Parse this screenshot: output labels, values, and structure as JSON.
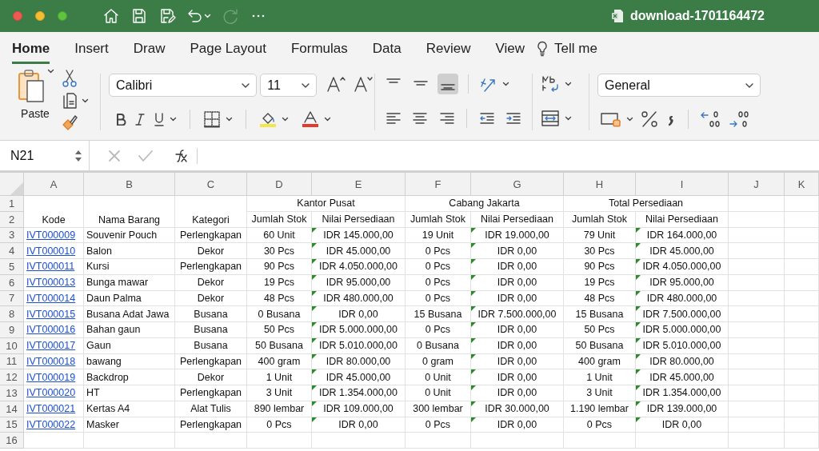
{
  "window": {
    "title": "download-1701164472"
  },
  "quick_access": [
    {
      "kind": "home",
      "disabled": false
    },
    {
      "kind": "save",
      "disabled": false
    },
    {
      "kind": "save-as",
      "disabled": false
    },
    {
      "kind": "undo",
      "disabled": false
    },
    {
      "kind": "redo",
      "disabled": true
    },
    {
      "kind": "more",
      "disabled": false
    }
  ],
  "tabs": [
    {
      "label": "Home",
      "selected": true
    },
    {
      "label": "Insert",
      "selected": false
    },
    {
      "label": "Draw",
      "selected": false
    },
    {
      "label": "Page Layout",
      "selected": false
    },
    {
      "label": "Formulas",
      "selected": false
    },
    {
      "label": "Data",
      "selected": false
    },
    {
      "label": "Review",
      "selected": false
    },
    {
      "label": "View",
      "selected": false
    }
  ],
  "tell_me": "Tell me",
  "ribbon": {
    "paste_label": "Paste",
    "font_name": "Calibri",
    "font_size": "11",
    "number_format": "General",
    "vertical_align": [
      {
        "selected": false
      },
      {
        "selected": false
      },
      {
        "selected": true
      }
    ]
  },
  "formula_bar": {
    "name_box": "N21"
  },
  "table": {
    "columns": [
      {
        "letter": "A",
        "kind": "link",
        "error_flag": false
      },
      {
        "letter": "B",
        "kind": "text",
        "error_flag": false
      },
      {
        "letter": "C",
        "kind": "value",
        "error_flag": false
      },
      {
        "letter": "D",
        "kind": "value",
        "error_flag": false
      },
      {
        "letter": "E",
        "kind": "value",
        "error_flag": true
      },
      {
        "letter": "F",
        "kind": "value",
        "error_flag": false
      },
      {
        "letter": "G",
        "kind": "value",
        "error_flag": true
      },
      {
        "letter": "H",
        "kind": "value",
        "error_flag": false
      },
      {
        "letter": "I",
        "kind": "value",
        "error_flag": true
      },
      {
        "letter": "J",
        "kind": "value",
        "error_flag": false
      },
      {
        "letter": "K",
        "kind": "value",
        "error_flag": false
      }
    ],
    "header_row_numbers": [
      "1",
      "2"
    ],
    "group_headers": [
      "Kantor Pusat",
      "Cabang Jakarta",
      "Total Persediaan"
    ],
    "column_headers": [
      "Kode",
      "Nama Barang",
      "Kategori",
      "Jumlah Stok",
      "Nilai Persediaan",
      "Jumlah Stok",
      "Nilai Persediaan",
      "Jumlah Stok",
      "Nilai Persediaan"
    ],
    "rows": [
      {
        "number": "3",
        "cells": [
          "IVT000009",
          "Souvenir Pouch",
          "Perlengkapan",
          "60 Unit",
          "IDR 145.000,00",
          "19 Unit",
          "IDR 19.000,00",
          "79 Unit",
          "IDR 164.000,00"
        ]
      },
      {
        "number": "4",
        "cells": [
          "IVT000010",
          "Balon",
          "Dekor",
          "30 Pcs",
          "IDR 45.000,00",
          "0 Pcs",
          "IDR 0,00",
          "30 Pcs",
          "IDR 45.000,00"
        ]
      },
      {
        "number": "5",
        "cells": [
          "IVT000011",
          "Kursi",
          "Perlengkapan",
          "90 Pcs",
          "IDR 4.050.000,00",
          "0 Pcs",
          "IDR 0,00",
          "90 Pcs",
          "IDR 4.050.000,00"
        ]
      },
      {
        "number": "6",
        "cells": [
          "IVT000013",
          "Bunga mawar",
          "Dekor",
          "19 Pcs",
          "IDR 95.000,00",
          "0 Pcs",
          "IDR 0,00",
          "19 Pcs",
          "IDR 95.000,00"
        ]
      },
      {
        "number": "7",
        "cells": [
          "IVT000014",
          "Daun Palma",
          "Dekor",
          "48 Pcs",
          "IDR 480.000,00",
          "0 Pcs",
          "IDR 0,00",
          "48 Pcs",
          "IDR 480.000,00"
        ]
      },
      {
        "number": "8",
        "cells": [
          "IVT000015",
          "Busana Adat Jawa",
          "Busana",
          "0 Busana",
          "IDR 0,00",
          "15 Busana",
          "IDR 7.500.000,00",
          "15 Busana",
          "IDR 7.500.000,00"
        ]
      },
      {
        "number": "9",
        "cells": [
          "IVT000016",
          "Bahan gaun",
          "Busana",
          "50 Pcs",
          "IDR 5.000.000,00",
          "0 Pcs",
          "IDR 0,00",
          "50 Pcs",
          "IDR 5.000.000,00"
        ]
      },
      {
        "number": "10",
        "cells": [
          "IVT000017",
          "Gaun",
          "Busana",
          "50 Busana",
          "IDR 5.010.000,00",
          "0 Busana",
          "IDR 0,00",
          "50 Busana",
          "IDR 5.010.000,00"
        ]
      },
      {
        "number": "11",
        "cells": [
          "IVT000018",
          "bawang",
          "Perlengkapan",
          "400 gram",
          "IDR 80.000,00",
          "0 gram",
          "IDR 0,00",
          "400 gram",
          "IDR 80.000,00"
        ]
      },
      {
        "number": "12",
        "cells": [
          "IVT000019",
          "Backdrop",
          "Dekor",
          "1 Unit",
          "IDR 45.000,00",
          "0 Unit",
          "IDR 0,00",
          "1 Unit",
          "IDR 45.000,00"
        ]
      },
      {
        "number": "13",
        "cells": [
          "IVT000020",
          "HT",
          "Perlengkapan",
          "3 Unit",
          "IDR 1.354.000,00",
          "0 Unit",
          "IDR 0,00",
          "3 Unit",
          "IDR 1.354.000,00"
        ]
      },
      {
        "number": "14",
        "cells": [
          "IVT000021",
          "Kertas A4",
          "Alat Tulis",
          "890 lembar",
          "IDR 109.000,00",
          "300 lembar",
          "IDR 30.000,00",
          "1.190 lembar",
          "IDR 139.000,00"
        ]
      },
      {
        "number": "15",
        "cells": [
          "IVT000022",
          "Masker",
          "Perlengkapan",
          "0 Pcs",
          "IDR 0,00",
          "0 Pcs",
          "IDR 0,00",
          "0 Pcs",
          "IDR 0,00"
        ]
      },
      {
        "number": "16",
        "cells": []
      }
    ]
  }
}
